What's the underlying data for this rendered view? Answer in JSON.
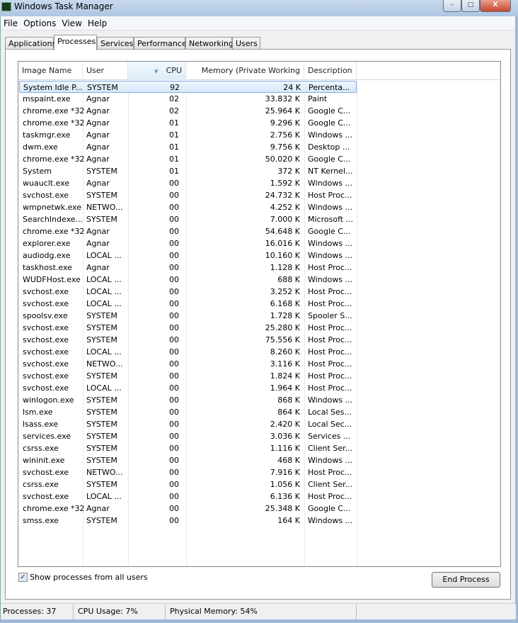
{
  "window": {
    "title": "Windows Task Manager",
    "minimize": "–",
    "maximize": "□",
    "close": "X"
  },
  "menu": [
    "File",
    "Options",
    "View",
    "Help"
  ],
  "tabs": [
    "Applications",
    "Processes",
    "Services",
    "Performance",
    "Networking",
    "Users"
  ],
  "active_tab": "Processes",
  "columns": [
    "Image Name",
    "User Name",
    "CPU",
    "Memory (Private Working Set)",
    "Description"
  ],
  "sorted_column": "CPU",
  "selected_row": 0,
  "rows": [
    [
      "System Idle P...",
      "SYSTEM",
      "92",
      "24 K",
      "Percenta..."
    ],
    [
      "mspaint.exe",
      "Agnar",
      "02",
      "33.832 K",
      "Paint"
    ],
    [
      "chrome.exe *32",
      "Agnar",
      "02",
      "25.964 K",
      "Google C..."
    ],
    [
      "chrome.exe *32",
      "Agnar",
      "01",
      "9.296 K",
      "Google C..."
    ],
    [
      "taskmgr.exe",
      "Agnar",
      "01",
      "2.756 K",
      "Windows ..."
    ],
    [
      "dwm.exe",
      "Agnar",
      "01",
      "9.756 K",
      "Desktop ..."
    ],
    [
      "chrome.exe *32",
      "Agnar",
      "01",
      "50.020 K",
      "Google C..."
    ],
    [
      "System",
      "SYSTEM",
      "01",
      "372 K",
      "NT Kernel..."
    ],
    [
      "wuauclt.exe",
      "Agnar",
      "00",
      "1.592 K",
      "Windows ..."
    ],
    [
      "svchost.exe",
      "SYSTEM",
      "00",
      "24.732 K",
      "Host Proc..."
    ],
    [
      "wmpnetwk.exe",
      "NETWO...",
      "00",
      "4.252 K",
      "Windows ..."
    ],
    [
      "SearchIndexe...",
      "SYSTEM",
      "00",
      "7.000 K",
      "Microsoft ..."
    ],
    [
      "chrome.exe *32",
      "Agnar",
      "00",
      "54.648 K",
      "Google C..."
    ],
    [
      "explorer.exe",
      "Agnar",
      "00",
      "16.016 K",
      "Windows ..."
    ],
    [
      "audiodg.exe",
      "LOCAL ...",
      "00",
      "10.160 K",
      "Windows ..."
    ],
    [
      "taskhost.exe",
      "Agnar",
      "00",
      "1.128 K",
      "Host Proc..."
    ],
    [
      "WUDFHost.exe",
      "LOCAL ...",
      "00",
      "688 K",
      "Windows ..."
    ],
    [
      "svchost.exe",
      "LOCAL ...",
      "00",
      "3.252 K",
      "Host Proc..."
    ],
    [
      "svchost.exe",
      "LOCAL ...",
      "00",
      "6.168 K",
      "Host Proc..."
    ],
    [
      "spoolsv.exe",
      "SYSTEM",
      "00",
      "1.728 K",
      "Spooler S..."
    ],
    [
      "svchost.exe",
      "SYSTEM",
      "00",
      "25.280 K",
      "Host Proc..."
    ],
    [
      "svchost.exe",
      "SYSTEM",
      "00",
      "75.556 K",
      "Host Proc..."
    ],
    [
      "svchost.exe",
      "LOCAL ...",
      "00",
      "8.260 K",
      "Host Proc..."
    ],
    [
      "svchost.exe",
      "NETWO...",
      "00",
      "3.116 K",
      "Host Proc..."
    ],
    [
      "svchost.exe",
      "SYSTEM",
      "00",
      "1.824 K",
      "Host Proc..."
    ],
    [
      "svchost.exe",
      "LOCAL ...",
      "00",
      "1.964 K",
      "Host Proc..."
    ],
    [
      "winlogon.exe",
      "SYSTEM",
      "00",
      "868 K",
      "Windows ..."
    ],
    [
      "lsm.exe",
      "SYSTEM",
      "00",
      "864 K",
      "Local Ses..."
    ],
    [
      "lsass.exe",
      "SYSTEM",
      "00",
      "2.420 K",
      "Local Sec..."
    ],
    [
      "services.exe",
      "SYSTEM",
      "00",
      "3.036 K",
      "Services ..."
    ],
    [
      "csrss.exe",
      "SYSTEM",
      "00",
      "1.116 K",
      "Client Ser..."
    ],
    [
      "wininit.exe",
      "SYSTEM",
      "00",
      "468 K",
      "Windows ..."
    ],
    [
      "svchost.exe",
      "NETWO...",
      "00",
      "7.916 K",
      "Host Proc..."
    ],
    [
      "csrss.exe",
      "SYSTEM",
      "00",
      "1.056 K",
      "Client Ser..."
    ],
    [
      "svchost.exe",
      "LOCAL ...",
      "00",
      "6.136 K",
      "Host Proc..."
    ],
    [
      "chrome.exe *32",
      "Agnar",
      "00",
      "25.348 K",
      "Google C..."
    ],
    [
      "smss.exe",
      "SYSTEM",
      "00",
      "164 K",
      "Windows ..."
    ]
  ],
  "show_all": {
    "label": "Show processes from all users",
    "checked": true,
    "mark": "✓"
  },
  "end_process": "End Process",
  "status": {
    "processes": "Processes: 37",
    "cpu": "CPU Usage: 7%",
    "memory": "Physical Memory: 54%"
  }
}
